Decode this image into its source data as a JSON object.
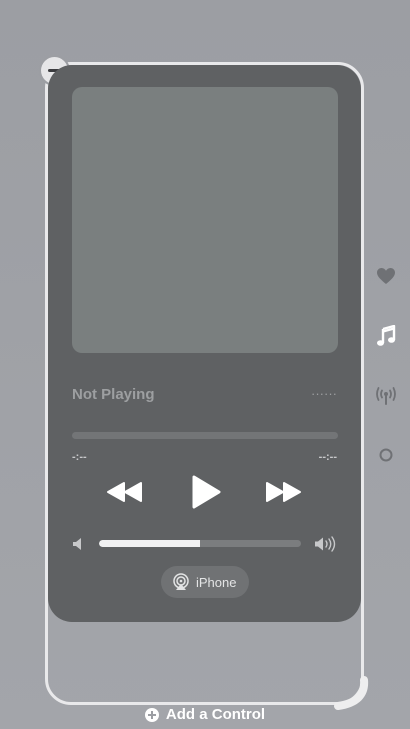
{
  "player": {
    "title": "Not Playing",
    "artist_placeholder": "······",
    "elapsed": "-:--",
    "remaining": "--:--",
    "volume_level": 0.5,
    "airplay_label": "iPhone"
  },
  "side_icons": [
    {
      "name": "favorites-heart-icon",
      "selected": false
    },
    {
      "name": "music-note-icon",
      "selected": true
    },
    {
      "name": "connectivity-antenna-icon",
      "selected": false
    },
    {
      "name": "circle-icon",
      "selected": false
    }
  ],
  "footer": {
    "add_control_label": "Add a Control"
  },
  "colors": {
    "background": "#9c9ea3",
    "player": "#5f6163",
    "artwork": "#7a7f7f",
    "frame": "#e9e9eb"
  }
}
